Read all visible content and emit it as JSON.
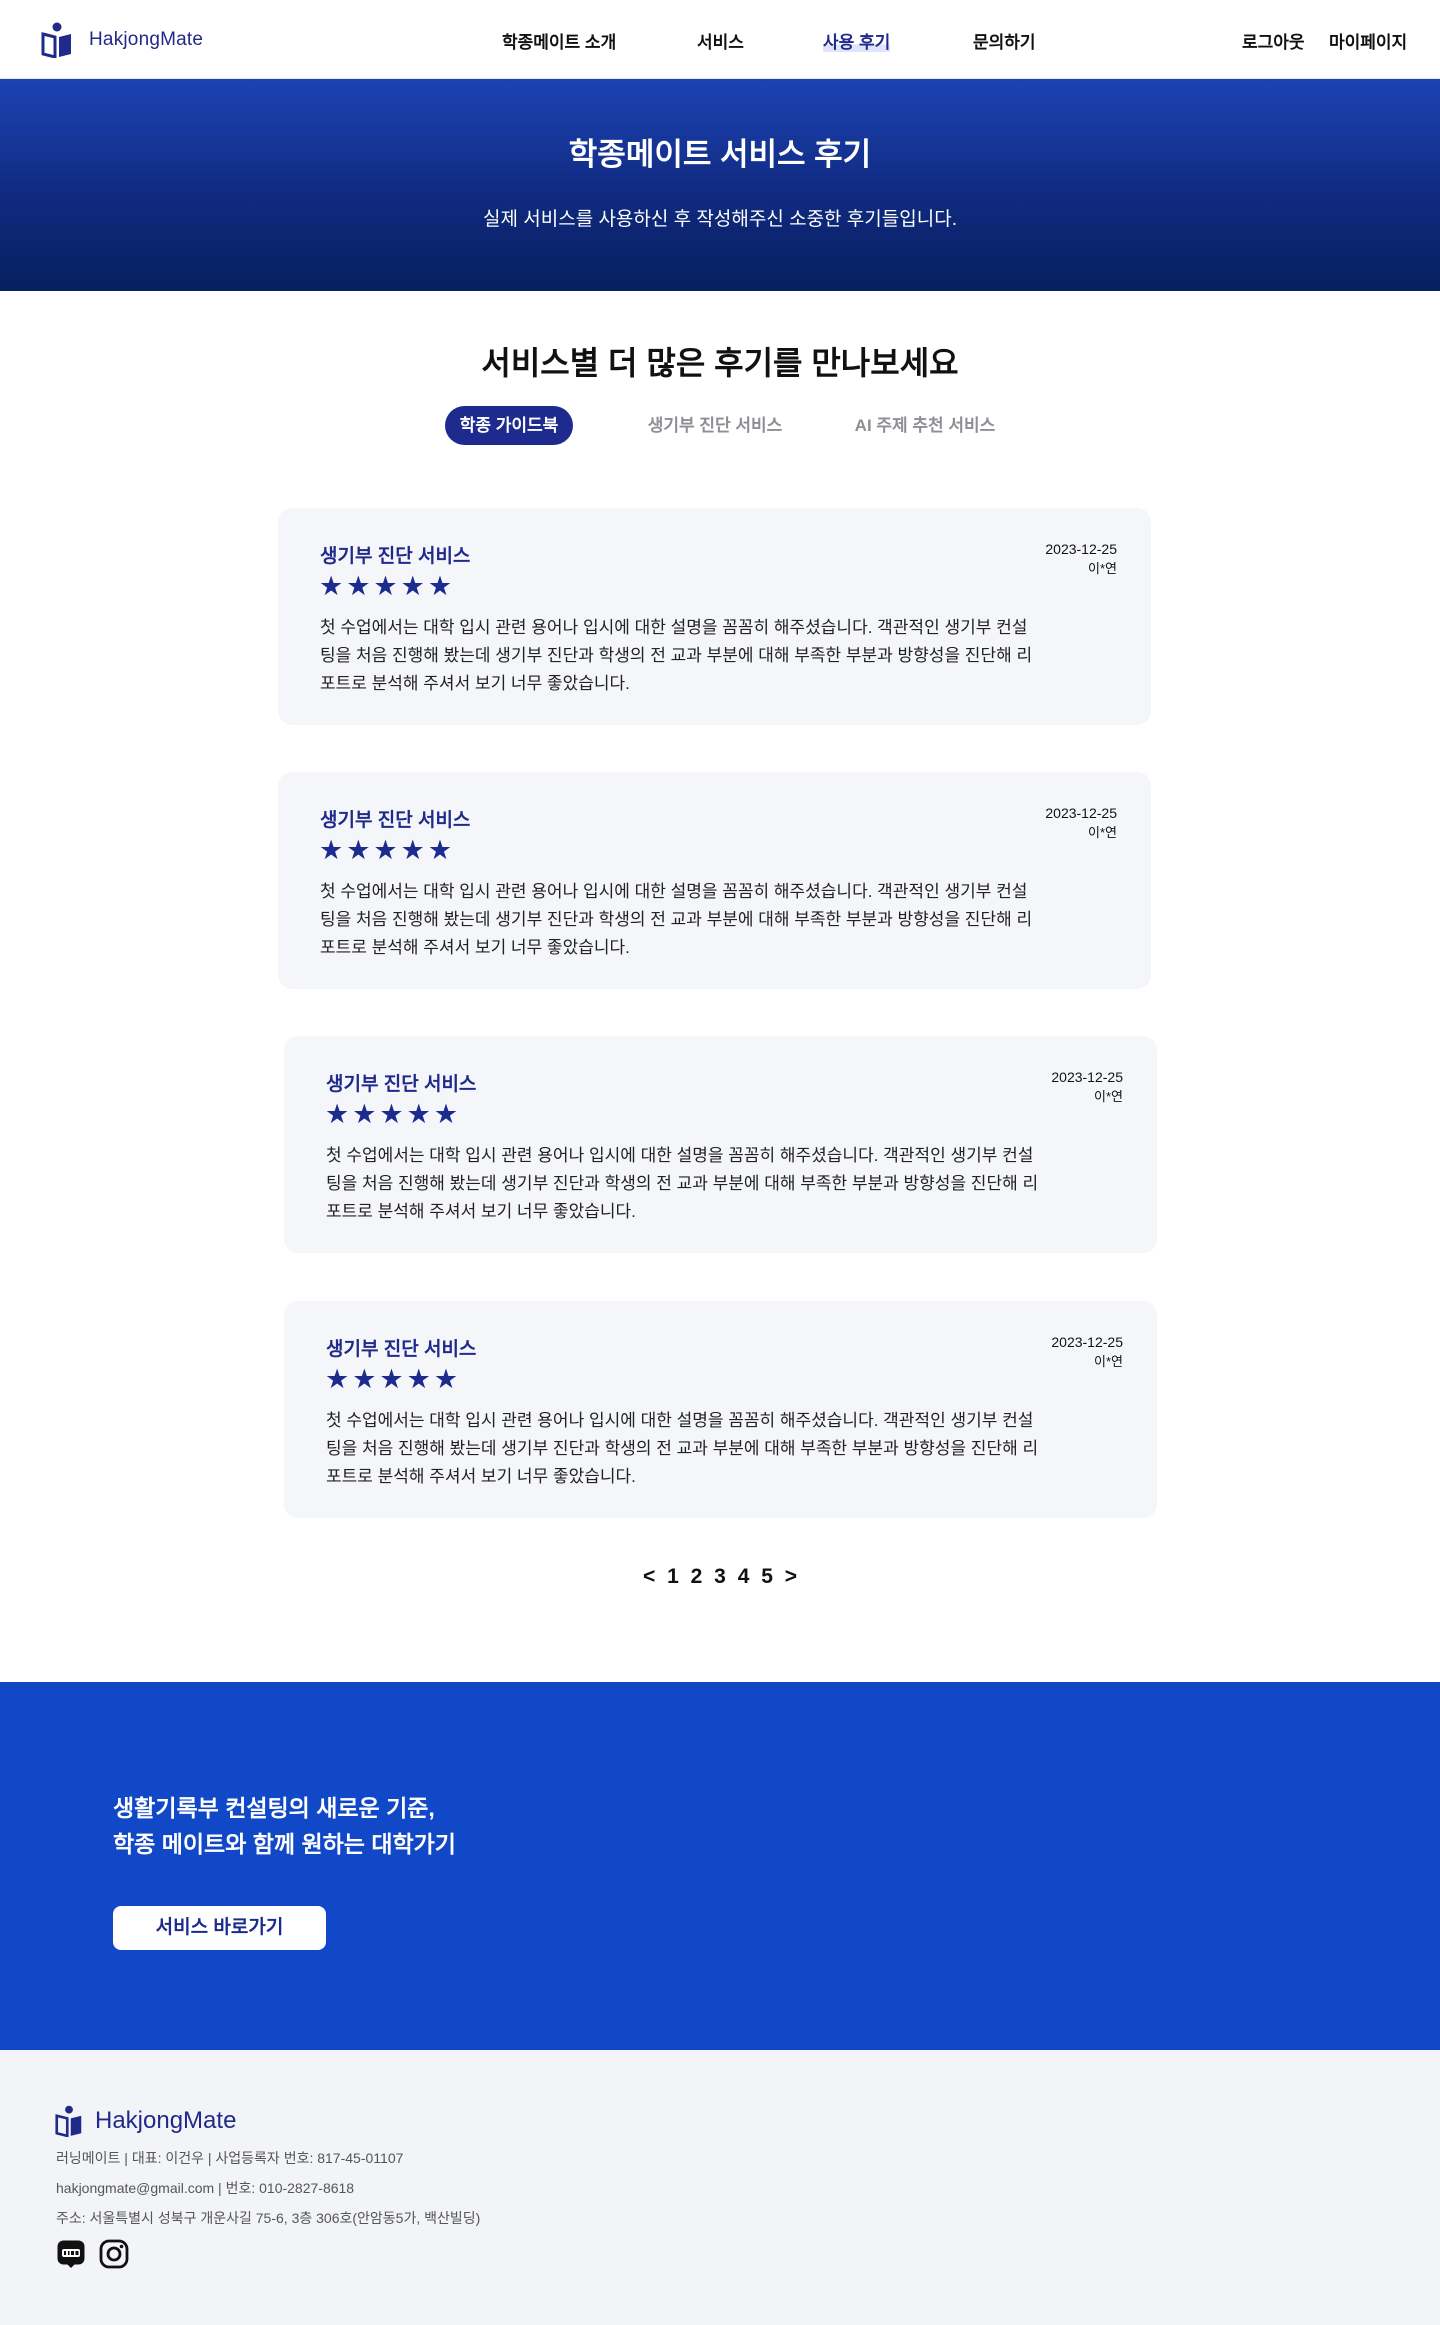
{
  "header": {
    "logo_text": "HakjongMate",
    "nav": [
      "학종메이트 소개",
      "서비스",
      "사용 후기",
      "문의하기"
    ],
    "active_nav": "사용 후기",
    "right": {
      "logout": "로그아웃",
      "mypage": "마이페이지"
    }
  },
  "hero": {
    "title": "학종메이트 서비스 후기",
    "subtitle": "실제 서비스를 사용하신 후 작성해주신 소중한 후기들입니다."
  },
  "section": {
    "title": "서비스별 더 많은 후기를 만나보세요",
    "tabs": [
      "학종 가이드북",
      "생기부 진단 서비스",
      "AI 주제 추천 서비스"
    ],
    "active_tab": "학종 가이드북"
  },
  "reviews": [
    {
      "service": "생기부 진단 서비스",
      "rating": 5,
      "stars": "★★★★★",
      "date": "2023-12-25",
      "author": "이*연",
      "text": "첫 수업에서는 대학 입시 관련 용어나 입시에 대한 설명을 꼼꼼히 해주셨습니다. 객관적인 생기부 컨설팅을 처음 진행해 봤는데 생기부 진단과 학생의 전 교과 부분에 대해 부족한 부분과 방향성을 진단해 리포트로 분석해 주셔서 보기 너무 좋았습니다."
    },
    {
      "service": "생기부 진단 서비스",
      "rating": 5,
      "stars": "★★★★★",
      "date": "2023-12-25",
      "author": "이*연",
      "text": "첫 수업에서는 대학 입시 관련 용어나 입시에 대한 설명을 꼼꼼히 해주셨습니다. 객관적인 생기부 컨설팅을 처음 진행해 봤는데 생기부 진단과 학생의 전 교과 부분에 대해 부족한 부분과 방향성을 진단해 리포트로 분석해 주셔서 보기 너무 좋았습니다."
    },
    {
      "service": "생기부 진단 서비스",
      "rating": 5,
      "stars": "★★★★★",
      "date": "2023-12-25",
      "author": "이*연",
      "text": "첫 수업에서는 대학 입시 관련 용어나 입시에 대한 설명을 꼼꼼히 해주셨습니다. 객관적인 생기부 컨설팅을 처음 진행해 봤는데 생기부 진단과 학생의 전 교과 부분에 대해 부족한 부분과 방향성을 진단해 리포트로 분석해 주셔서 보기 너무 좋았습니다."
    },
    {
      "service": "생기부 진단 서비스",
      "rating": 5,
      "stars": "★★★★★",
      "date": "2023-12-25",
      "author": "이*연",
      "text": "첫 수업에서는 대학 입시 관련 용어나 입시에 대한 설명을 꼼꼼히 해주셨습니다. 객관적인 생기부 컨설팅을 처음 진행해 봤는데 생기부 진단과 학생의 전 교과 부분에 대해 부족한 부분과 방향성을 진단해 리포트로 분석해 주셔서 보기 너무 좋았습니다."
    }
  ],
  "pagination": {
    "prev": "<",
    "pages": [
      "1",
      "2",
      "3",
      "4",
      "5"
    ],
    "next": ">"
  },
  "cta": {
    "line1": "생활기록부 컨설팅의 새로운 기준,",
    "line2": "학종 메이트와 함께 원하는 대학가기",
    "button": "서비스 바로가기"
  },
  "footer": {
    "logo_text": "HakjongMate",
    "line1": "러닝메이트 | 대표: 이건우 | 사업등록자 번호: 817-45-01107",
    "line2": "hakjongmate@gmail.com | 번호: 010-2827-8618",
    "line3": "주소: 서울특별시 성북구 개운사길 75-6, 3층 306호(안암동5가, 백산빌딩)",
    "social": [
      "blog-icon",
      "instagram-icon"
    ]
  },
  "colors": {
    "brand": "#1d2b8f",
    "hero_top": "#1c43b4",
    "hero_bottom": "#06205f",
    "cta_bg": "#1048c8",
    "card_bg": "#f5f6fa",
    "footer_bg": "#f3f4f8"
  }
}
